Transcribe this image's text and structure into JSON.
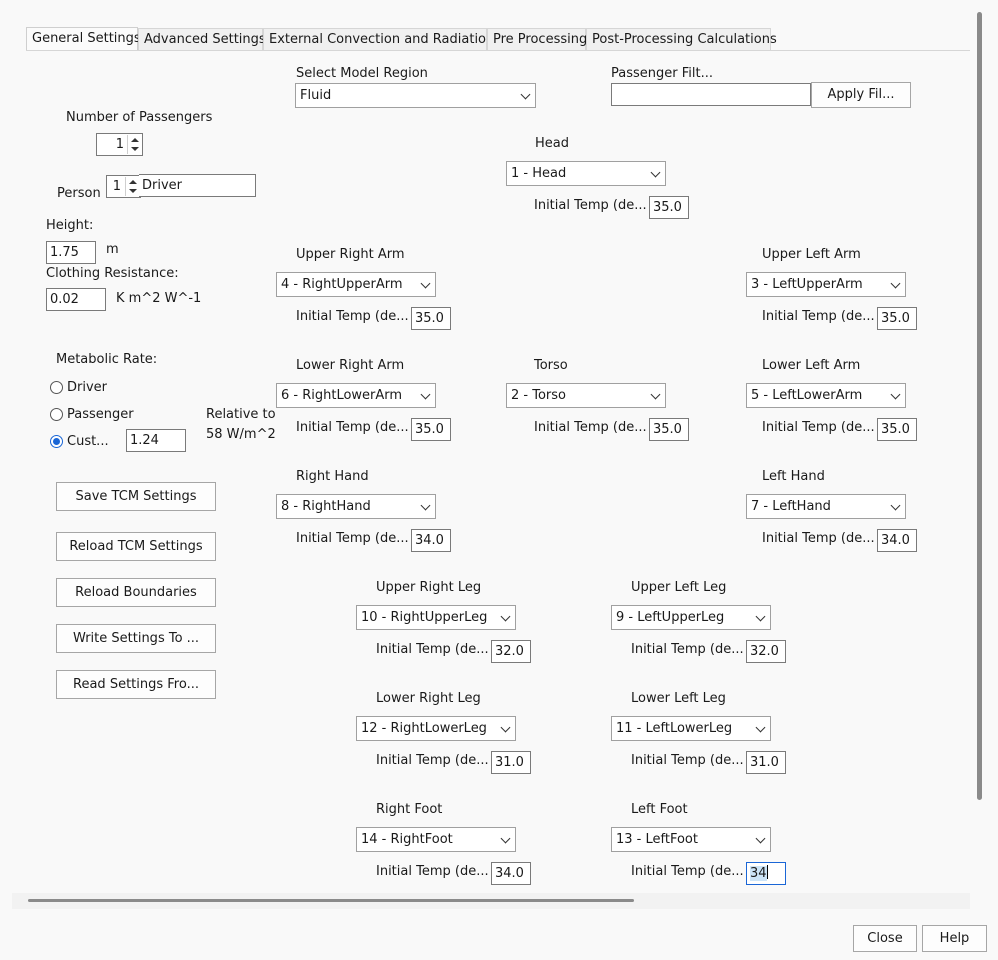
{
  "tabs": [
    {
      "label": "General Settings",
      "active": true
    },
    {
      "label": "Advanced Settings"
    },
    {
      "label": "External Convection and Radiation"
    },
    {
      "label": "Pre Processing"
    },
    {
      "label": "Post-Processing Calculations"
    }
  ],
  "model_region": {
    "label": "Select Model Region",
    "value": "Fluid"
  },
  "passenger_filter": {
    "label": "Passenger Filt...",
    "value": "",
    "button": "Apply Fil..."
  },
  "passengers": {
    "label": "Number of Passengers",
    "count": "1"
  },
  "person": {
    "label": "Person",
    "index": "1",
    "name": "Driver"
  },
  "height": {
    "label": "Height:",
    "value": "1.75",
    "unit": "m"
  },
  "clothing": {
    "label": "Clothing Resistance:",
    "value": "0.02",
    "unit": "K m^2 W^-1"
  },
  "metabolic": {
    "label": "Metabolic Rate:",
    "options": [
      "Driver",
      "Passenger",
      "Cust..."
    ],
    "selected": "Cust...",
    "custom_value": "1.24",
    "relative_label": "Relative to",
    "relative_value": "58 W/m^2"
  },
  "buttons": {
    "save": "Save TCM Settings",
    "reload_tcm": "Reload TCM Settings",
    "reload_boundaries": "Reload Boundaries",
    "write": "Write Settings To ...",
    "read": "Read Settings Fro...",
    "close": "Close",
    "help": "Help"
  },
  "init_temp_label": "Initial Temp (de...",
  "segments": {
    "head": {
      "title": "Head",
      "selected": "1 - Head",
      "temp": "35.0"
    },
    "upper_right_arm": {
      "title": "Upper Right Arm",
      "selected": "4 - RightUpperArm",
      "temp": "35.0"
    },
    "upper_left_arm": {
      "title": "Upper Left Arm",
      "selected": "3 - LeftUpperArm",
      "temp": "35.0"
    },
    "lower_right_arm": {
      "title": "Lower Right Arm",
      "selected": "6 - RightLowerArm",
      "temp": "35.0"
    },
    "torso": {
      "title": "Torso",
      "selected": "2 - Torso",
      "temp": "35.0"
    },
    "lower_left_arm": {
      "title": "Lower Left Arm",
      "selected": "5 - LeftLowerArm",
      "temp": "35.0"
    },
    "right_hand": {
      "title": "Right Hand",
      "selected": "8 - RightHand",
      "temp": "34.0"
    },
    "left_hand": {
      "title": "Left Hand",
      "selected": "7 - LeftHand",
      "temp": "34.0"
    },
    "upper_right_leg": {
      "title": "Upper Right Leg",
      "selected": "10 - RightUpperLeg",
      "temp": "32.0"
    },
    "upper_left_leg": {
      "title": "Upper Left Leg",
      "selected": "9 - LeftUpperLeg",
      "temp": "32.0"
    },
    "lower_right_leg": {
      "title": "Lower Right Leg",
      "selected": "12 - RightLowerLeg",
      "temp": "31.0"
    },
    "lower_left_leg": {
      "title": "Lower Left Leg",
      "selected": "11 - LeftLowerLeg",
      "temp": "31.0"
    },
    "right_foot": {
      "title": "Right Foot",
      "selected": "14 - RightFoot",
      "temp": "34.0"
    },
    "left_foot": {
      "title": "Left Foot",
      "selected": "13 - LeftFoot",
      "temp": "34"
    }
  },
  "colors": {
    "accent": "#1a66d6",
    "selection": "#cce4f7"
  }
}
